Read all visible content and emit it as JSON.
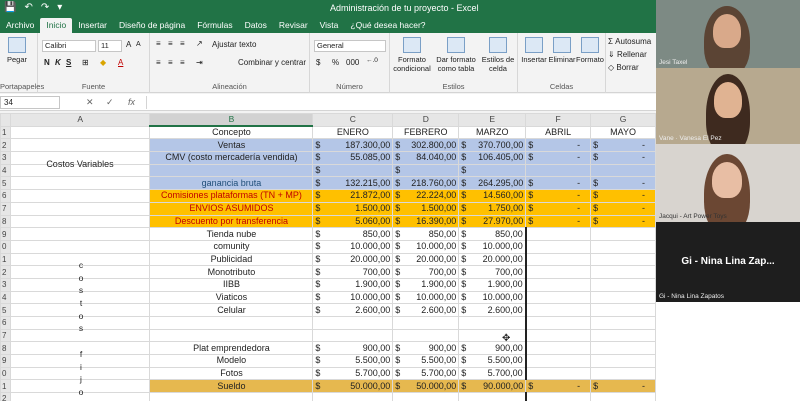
{
  "window": {
    "title": "Administración de tu proyecto  -  Excel",
    "qat": [
      "💾",
      "↶",
      "↷",
      "▾"
    ]
  },
  "ribbon_tabs": [
    "Archivo",
    "Inicio",
    "Insertar",
    "Diseño de página",
    "Fórmulas",
    "Datos",
    "Revisar",
    "Vista",
    "¿Qué desea hacer?"
  ],
  "ribbon": {
    "paste": "Pegar",
    "clipboard_group": "Portapapeles",
    "font_name": "Calibri",
    "font_size": "11",
    "bold": "N",
    "italic": "K",
    "underline": "S",
    "font_group": "Fuente",
    "wrap_text": "Ajustar texto",
    "merge_center": "Combinar y centrar",
    "alignment_group": "Alineación",
    "number_format": "General",
    "currency": "$",
    "percent": "%",
    "thousands": "000",
    "number_group": "Número",
    "cond_format": "Formato condicional",
    "format_table": "Dar formato como tabla",
    "cell_styles": "Estilos de celda",
    "styles_group": "Estilos",
    "insert": "Insertar",
    "delete": "Eliminar",
    "format": "Formato",
    "cells_group": "Celdas",
    "autosum": "Autosuma",
    "fill": "Rellenar",
    "clear": "Borrar"
  },
  "formula_bar": {
    "name_box": "34",
    "cancel": "✕",
    "enter": "✓",
    "fx": "fx",
    "value": ""
  },
  "columns": [
    "A",
    "B",
    "C",
    "D",
    "E",
    "F",
    "G"
  ],
  "sheet": {
    "a_label_costos_variables": "Costos Variables",
    "a_vertical": [
      "c",
      "o",
      "s",
      "t",
      "o",
      "s",
      "",
      "f",
      "i",
      "j",
      "o"
    ],
    "header": {
      "concepto": "Concepto",
      "months": [
        "ENERO",
        "FEBRERO",
        "MARZO",
        "ABRIL",
        "MAYO"
      ]
    },
    "rows": [
      {
        "n": "1",
        "style": "header"
      },
      {
        "n": "2",
        "style": "blue",
        "concept": "Ventas",
        "vals": [
          "187.300,00",
          "302.800,00",
          "370.700,00",
          "-",
          "-"
        ]
      },
      {
        "n": "3",
        "style": "blue",
        "concept": "CMV (costo mercadería vendida)",
        "vals": [
          "55.085,00",
          "84.040,00",
          "106.405,00",
          "-",
          "-"
        ]
      },
      {
        "n": "4",
        "style": "blue",
        "concept": "",
        "vals": [
          "",
          "",
          "",
          "",
          ""
        ]
      },
      {
        "n": "5",
        "style": "blue",
        "concept": "ganancia bruta",
        "vals": [
          "132.215,00",
          "218.760,00",
          "264.295,00",
          "-",
          "-"
        ]
      },
      {
        "n": "6",
        "style": "orange",
        "concept": "Comisiones plataformas (TN + MP)",
        "vals": [
          "21.872,00",
          "22.224,00",
          "14.560,00",
          "-",
          "-"
        ]
      },
      {
        "n": "7",
        "style": "orange",
        "concept": "ENVIOS ASUMIDOS",
        "vals": [
          "1.500,00",
          "1.500,00",
          "1.750,00",
          "-",
          "-"
        ]
      },
      {
        "n": "8",
        "style": "orange",
        "concept": "Descuento por transferencia",
        "vals": [
          "5.060,00",
          "16.390,00",
          "27.970,00",
          "-",
          "-"
        ]
      },
      {
        "n": "9",
        "style": "plain",
        "concept": "Tienda nube",
        "vals": [
          "850,00",
          "850,00",
          "850,00",
          "",
          ""
        ]
      },
      {
        "n": "0",
        "style": "plain",
        "concept": "comunity",
        "vals": [
          "10.000,00",
          "10.000,00",
          "10.000,00",
          "",
          ""
        ]
      },
      {
        "n": "1",
        "style": "plain",
        "concept": "Publicidad",
        "vals": [
          "20.000,00",
          "20.000,00",
          "20.000,00",
          "",
          ""
        ]
      },
      {
        "n": "2",
        "style": "plain",
        "concept": "Monotributo",
        "vals": [
          "700,00",
          "700,00",
          "700,00",
          "",
          ""
        ]
      },
      {
        "n": "3",
        "style": "plain",
        "concept": "IIBB",
        "vals": [
          "1.900,00",
          "1.900,00",
          "1.900,00",
          "",
          ""
        ]
      },
      {
        "n": "4",
        "style": "plain",
        "concept": "Viaticos",
        "vals": [
          "10.000,00",
          "10.000,00",
          "10.000,00",
          "",
          ""
        ]
      },
      {
        "n": "5",
        "style": "plain",
        "concept": "Celular",
        "vals": [
          "2.600,00",
          "2.600,00",
          "2.600,00",
          "",
          ""
        ]
      },
      {
        "n": "6",
        "style": "plain",
        "concept": "",
        "vals": [
          "",
          "",
          "",
          "",
          ""
        ]
      },
      {
        "n": "7",
        "style": "plain",
        "concept": "",
        "vals": [
          "",
          "",
          "",
          "",
          ""
        ]
      },
      {
        "n": "8",
        "style": "plain",
        "concept": "Plat emprendedora",
        "vals": [
          "900,00",
          "900,00",
          "900,00",
          "",
          ""
        ]
      },
      {
        "n": "9",
        "style": "plain",
        "concept": "Modelo",
        "vals": [
          "5.500,00",
          "5.500,00",
          "5.500,00",
          "",
          ""
        ]
      },
      {
        "n": "0",
        "style": "plain",
        "concept": "Fotos",
        "vals": [
          "5.700,00",
          "5.700,00",
          "5.700,00",
          "",
          ""
        ]
      },
      {
        "n": "1",
        "style": "gold",
        "concept": "Sueldo",
        "vals": [
          "50.000,00",
          "50.000,00",
          "90.000,00",
          "-",
          "-"
        ]
      },
      {
        "n": "2",
        "style": "plain",
        "concept": "",
        "vals": [
          "",
          "",
          "",
          "",
          ""
        ]
      }
    ]
  },
  "participants": [
    {
      "name": "Jesi Taxel",
      "caption": "Jesi Taxel"
    },
    {
      "name": "Vanesa Pez",
      "caption": "Vane · Vanesa El Pez"
    },
    {
      "name": "Jacqui Art Power Toys",
      "caption": "Jacqui - Art Power Toys"
    },
    {
      "name": "Gi - Nina Lina Zapatos",
      "tile_label": "Gi - Nina Lina Zap...",
      "caption": "Gi - Nina Lina Zapatos"
    }
  ],
  "colors": {
    "excel_green": "#217346",
    "row_blue": "#b4c6e7",
    "row_orange": "#ffc000",
    "row_gold": "#e6b84f",
    "text_red": "#c00000"
  }
}
